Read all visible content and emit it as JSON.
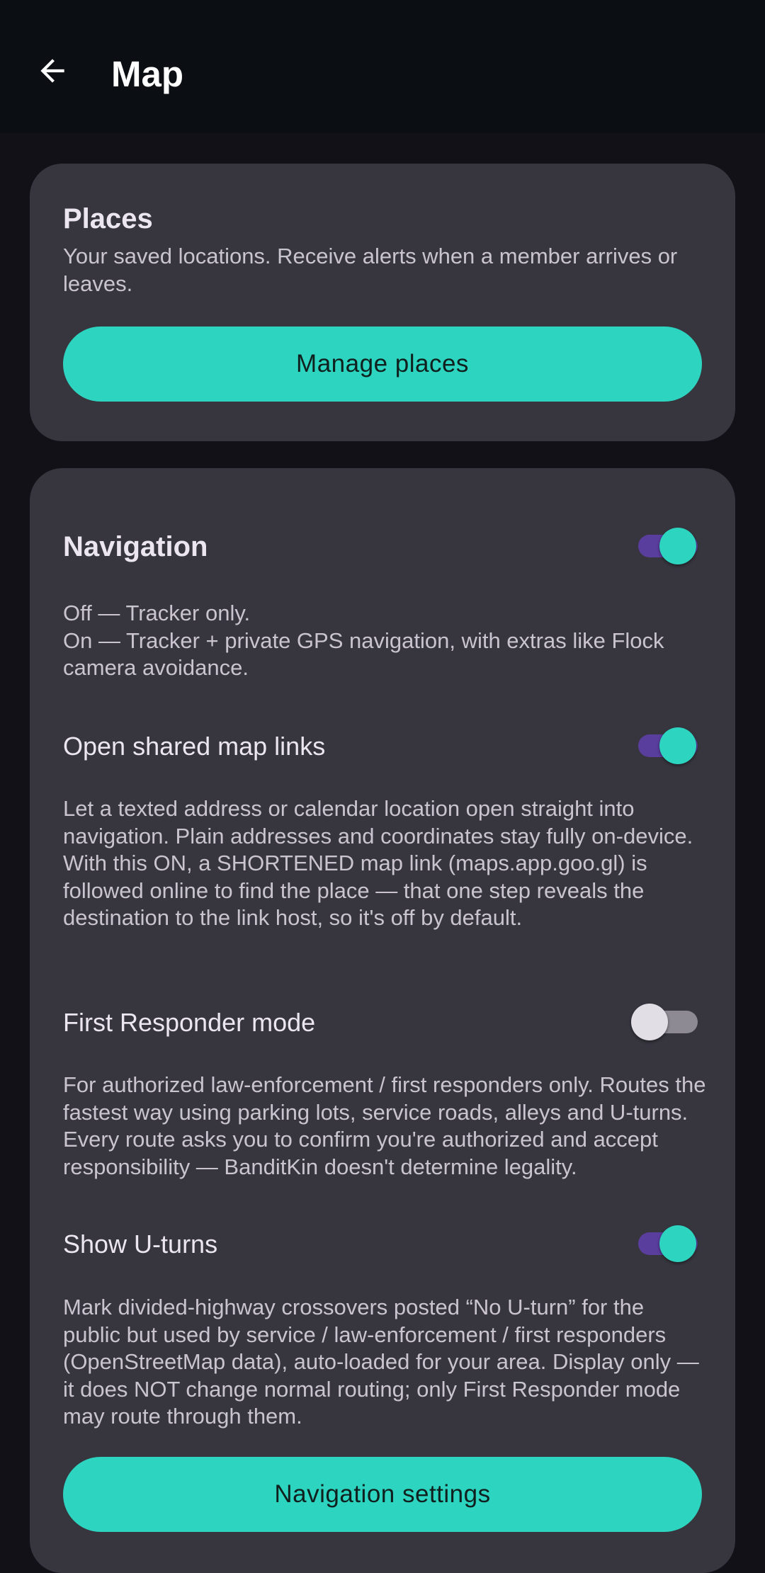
{
  "appbar": {
    "title": "Map",
    "back_icon": "arrow-back-icon"
  },
  "places": {
    "title": "Places",
    "description": "Your saved locations. Receive alerts when a member arrives or leaves.",
    "button_label": "Manage places"
  },
  "navigation": {
    "title": "Navigation",
    "enabled": true,
    "description_line1": "Off — Tracker only.",
    "description_line2": "On — Tracker + private GPS navigation, with extras like Flock camera avoidance.",
    "settings_button_label": "Navigation settings",
    "options": [
      {
        "label": "Open shared map links",
        "enabled": true,
        "description": "Let a texted address or calendar location open straight into navigation. Plain addresses and coordinates stay fully on-device. With this ON, a SHORTENED map link (maps.app.goo.gl) is followed online to find the place — that one step reveals the destination to the link host, so it's off by default."
      },
      {
        "label": "First Responder mode",
        "enabled": false,
        "description": "For authorized law-enforcement / first responders only. Routes the fastest way using parking lots, service roads, alleys and U-turns. Every route asks you to confirm you're authorized and accept responsibility — BanditKin doesn't determine legality."
      },
      {
        "label": "Show U-turns",
        "enabled": true,
        "description": "Mark divided-highway crossovers posted “No U-turn” for the public but used by service / law-enforcement / first responders (OpenStreetMap data), auto-loaded for your area. Display only — it does NOT change normal routing; only First Responder mode may route through them."
      }
    ]
  },
  "colors": {
    "accent": "#2dd4bf",
    "switch_track_on": "#5a3e9e",
    "card_background": "#37363f",
    "page_background": "#121118",
    "appbar_background": "#0b0e13"
  }
}
